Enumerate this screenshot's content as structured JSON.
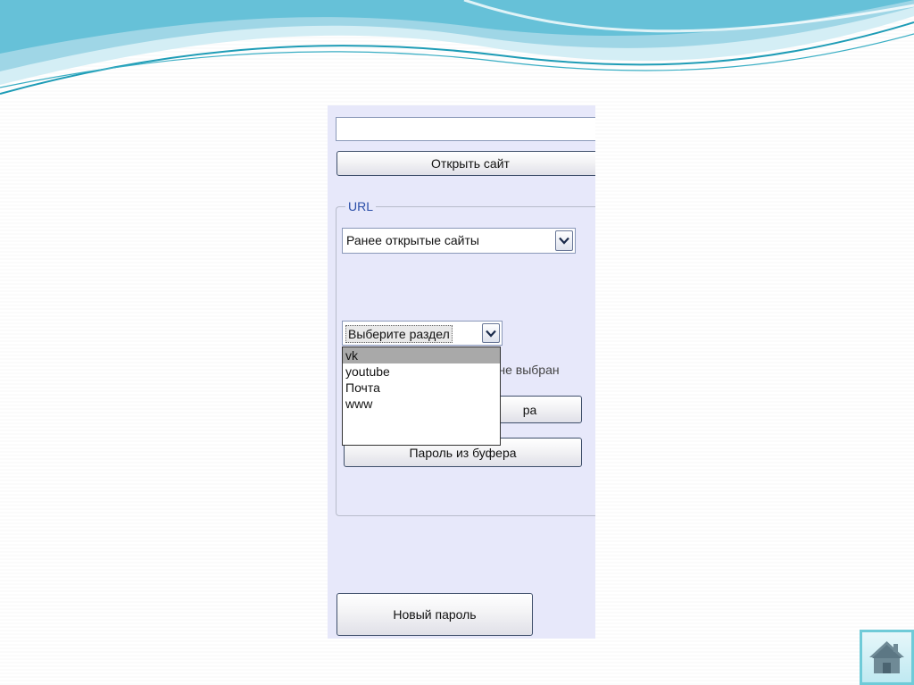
{
  "url_input": {
    "value": ""
  },
  "open_site_button": {
    "label": "Открыть сайт"
  },
  "url_group": {
    "legend": "URL",
    "sites_combo": {
      "selected": "Ранее открытые сайты"
    }
  },
  "section_combo": {
    "selected": "Выберите раздел",
    "options": [
      "vk",
      "youtube",
      "Почта",
      "www"
    ],
    "highlighted_index": 0
  },
  "status": {
    "text": "ел не выбран"
  },
  "copy_button": {
    "label": "ра"
  },
  "paste_button": {
    "label": "Пароль из буфера"
  },
  "new_password_button": {
    "label": "Новый пароль"
  },
  "colors": {
    "panel_bg": "#e7e8fa",
    "legend_text": "#2a4ea8",
    "wave_teal": "#2fb3c9",
    "wave_light": "#bfe6f0",
    "home_border": "#6fcbd8"
  },
  "icons": {
    "dropdown": "chevron-down-icon",
    "home": "home-icon"
  }
}
